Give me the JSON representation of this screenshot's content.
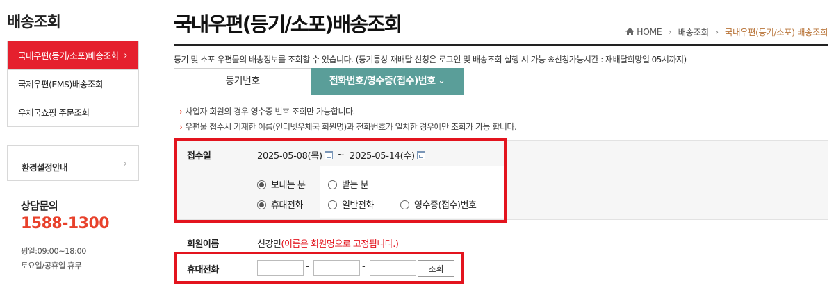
{
  "sidebar": {
    "title": "배송조회",
    "items": [
      {
        "label": "국내우편(등기/소포)배송조회",
        "active": true
      },
      {
        "label": "국제우편(EMS)배송조회",
        "active": false
      },
      {
        "label": "우체국쇼핑 주문조회",
        "active": false
      }
    ],
    "active_chevron": "›",
    "env_label": "환경설정안내",
    "env_chevron": "›",
    "consult_title": "상담문의",
    "consult_phone": "1588-1300",
    "consult_hours": "평일:09:00~18:00",
    "consult_holiday": "토요일/공휴일 휴무"
  },
  "header": {
    "title": "국내우편(등기/소포)배송조회",
    "breadcrumb": [
      "HOME",
      "배송조회",
      "국내우편(등기/소포) 배송조회"
    ],
    "breadcrumb_sep": "›"
  },
  "intro": "등기 및 소포 우편물의 배송정보를 조회할 수 있습니다. (등기통상 재배달 신청은 로그인 및 배송조회 실행 시 가능 ※신청가능시간 : 재배달희망일 05시까지)",
  "tabs": {
    "registered": "등기번호",
    "phone": "전화번호/영수증(접수)번호",
    "phone_caret": "⌄"
  },
  "notes": [
    "사업자 회원의 경우 영수증 번호 조회만 가능합니다.",
    "우편물 접수시 기재한 이름(인터넷우체국 회원명)과 전화번호가 일치한 경우에만 조회가 가능 합니다."
  ],
  "note_bullet": "›",
  "form": {
    "receipt_date_label": "접수일",
    "date_from": "2025-05-08(목)",
    "date_sep": "~",
    "date_to": "2025-05-14(수)",
    "sender_options": [
      {
        "label": "보내는 분",
        "checked": true
      },
      {
        "label": "받는 분",
        "checked": false
      }
    ],
    "type_options": [
      {
        "label": "휴대전화",
        "checked": true
      },
      {
        "label": "일반전화",
        "checked": false
      },
      {
        "label": "영수증(접수)번호",
        "checked": false
      }
    ],
    "member_label": "회원이름",
    "member_name": "신강민",
    "member_note": "(이름은 회원명으로 고정됩니다.)",
    "phone_label": "휴대전화",
    "phone_parts": [
      "",
      "",
      ""
    ],
    "phone_sep": "-",
    "lookup_button": "조회"
  },
  "colors": {
    "active_menu": "#e5202e",
    "phone_tab": "#5a9e99",
    "highlight_box": "#e3141e",
    "consult_phone": "#e8412b",
    "breadcrumb_current": "#b9753a"
  }
}
